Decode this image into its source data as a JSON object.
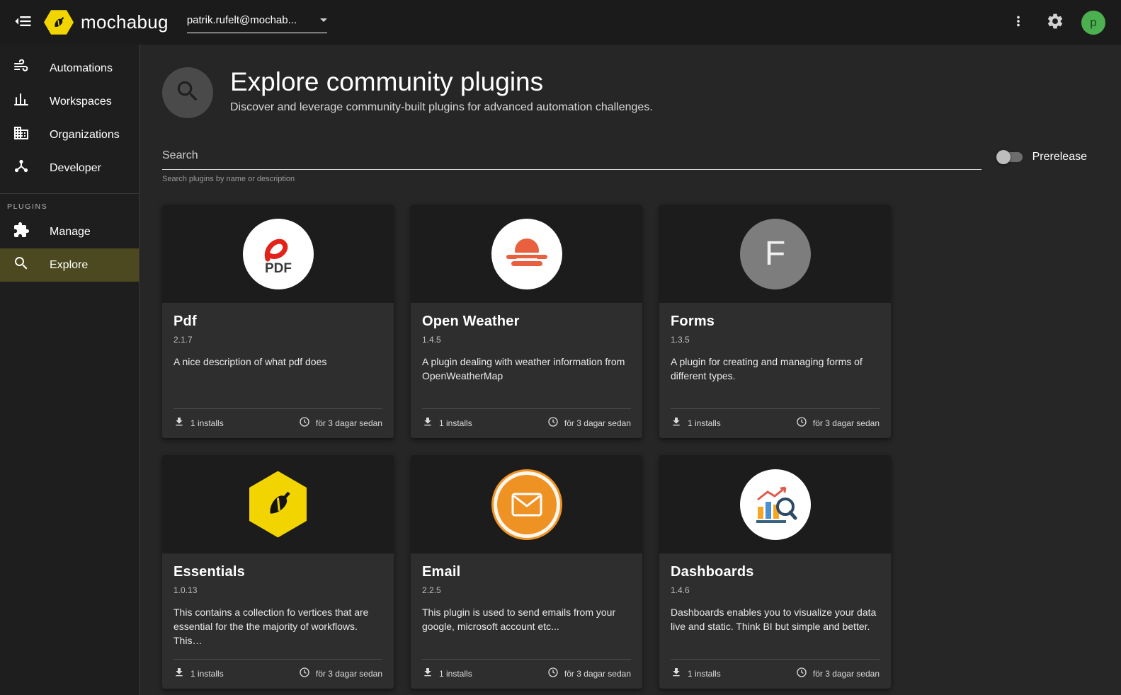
{
  "colors": {
    "brand_yellow": "#f2d500",
    "avatar_green": "#4caf50",
    "selected_item_olive": "#4c4920",
    "email_orange": "#ef9224",
    "pdf_red": "#e2231a"
  },
  "topbar": {
    "brand": "mochabug",
    "account": "patrik.rufelt@mochab...",
    "avatar_letter": "p"
  },
  "sidebar": {
    "items": [
      {
        "label": "Automations"
      },
      {
        "label": "Workspaces"
      },
      {
        "label": "Organizations"
      },
      {
        "label": "Developer"
      }
    ],
    "section_label": "PLUGINS",
    "plugin_items": [
      {
        "label": "Manage"
      },
      {
        "label": "Explore",
        "selected": true
      }
    ]
  },
  "header": {
    "title": "Explore community plugins",
    "subtitle": "Discover and leverage community-built plugins for advanced automation challenges."
  },
  "search": {
    "placeholder": "Search",
    "helper": "Search plugins by name or description",
    "prerelease_label": "Prerelease",
    "prerelease_enabled": false
  },
  "cards": [
    {
      "name": "Pdf",
      "version": "2.1.7",
      "description": "A nice description of what pdf does",
      "installs": "1 installs",
      "updated": "för 3 dagar sedan",
      "logo": "pdf-logo",
      "logo_text": "PDF"
    },
    {
      "name": "Open Weather",
      "version": "1.4.5",
      "description": "A plugin dealing with weather information from OpenWeatherMap",
      "installs": "1 installs",
      "updated": "för 3 dagar sedan",
      "logo": "openweather-logo"
    },
    {
      "name": "Forms",
      "version": "1.3.5",
      "description": "A plugin for creating and managing forms of different types.",
      "installs": "1 installs",
      "updated": "för 3 dagar sedan",
      "logo": "forms-logo",
      "logo_letter": "F"
    },
    {
      "name": "Essentials",
      "version": "1.0.13",
      "description": "This contains a collection fo vertices that are essential for the the majority of workflows. This…",
      "installs": "1 installs",
      "updated": "för 3 dagar sedan",
      "logo": "essentials-logo"
    },
    {
      "name": "Email",
      "version": "2.2.5",
      "description": "This plugin is used to send emails from your google, microsoft account etc...",
      "installs": "1 installs",
      "updated": "för 3 dagar sedan",
      "logo": "email-logo"
    },
    {
      "name": "Dashboards",
      "version": "1.4.6",
      "description": "Dashboards enables you to visualize your data live and static. Think BI but simple and better.",
      "installs": "1 installs",
      "updated": "för 3 dagar sedan",
      "logo": "dashboards-logo"
    }
  ]
}
